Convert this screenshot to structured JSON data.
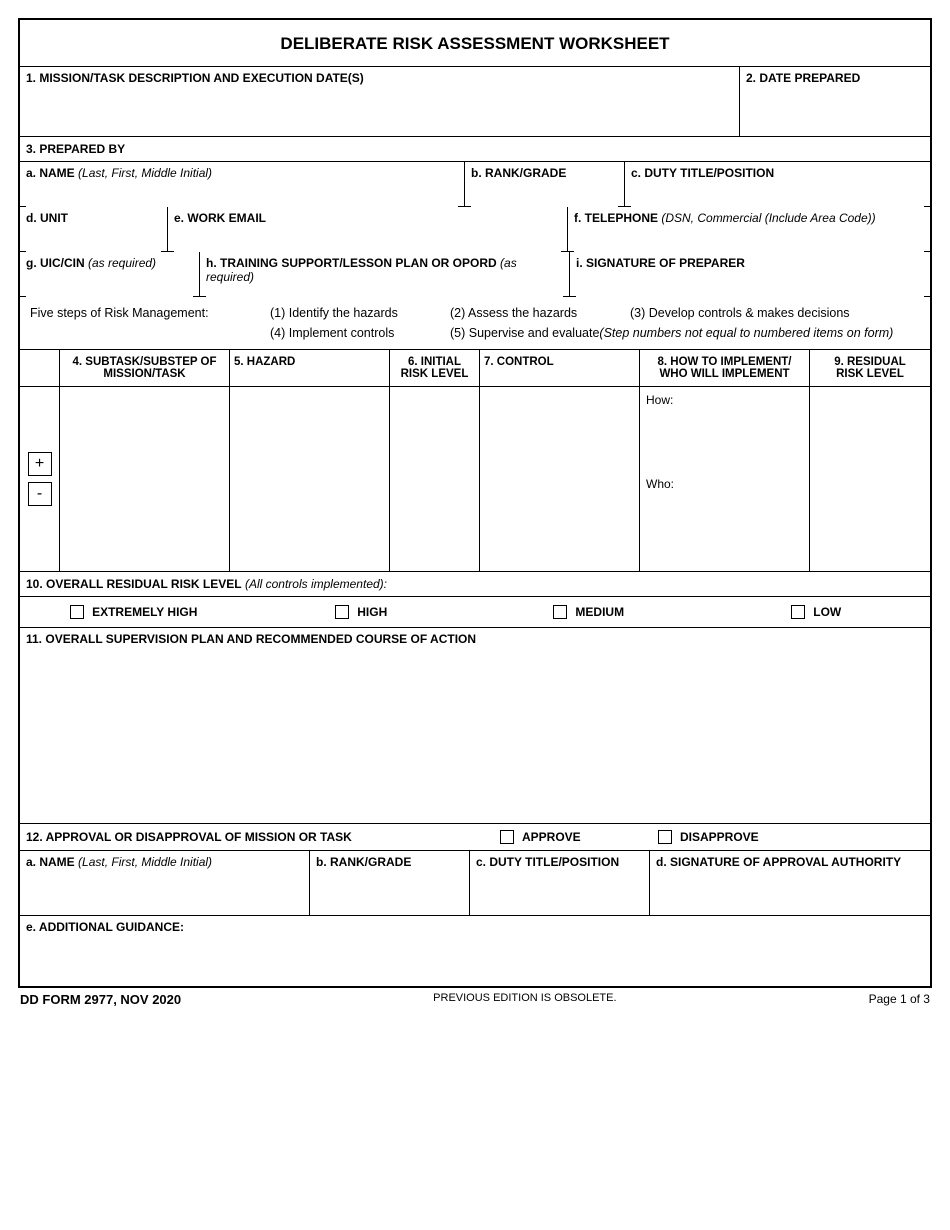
{
  "title": "DELIBERATE RISK ASSESSMENT WORKSHEET",
  "fields": {
    "f1": "1. MISSION/TASK DESCRIPTION AND EXECUTION DATE(S)",
    "f2": "2. DATE PREPARED",
    "f3": "3. PREPARED BY",
    "f3a_label": "a. NAME",
    "f3a_hint": " (Last, First, Middle Initial)",
    "f3b": "b. RANK/GRADE",
    "f3c": "c. DUTY TITLE/POSITION",
    "f3d": "d. UNIT",
    "f3e": "e. WORK EMAIL",
    "f3f_label": "f. TELEPHONE",
    "f3f_hint": " (DSN, Commercial (Include Area Code))",
    "f3g_label": "g. UIC/CIN",
    "f3g_hint": " (as required)",
    "f3h_label": "h. TRAINING SUPPORT/LESSON PLAN OR OPORD",
    "f3h_hint": " (as required)",
    "f3i": "i. SIGNATURE OF PREPARER"
  },
  "steps": {
    "intro": "Five steps of Risk Management:",
    "s1": "(1) Identify the hazards",
    "s2": "(2) Assess the hazards",
    "s3": "(3) Develop controls & makes decisions",
    "s4": "(4) Implement controls",
    "s5_label": "(5) Supervise and evaluate",
    "s5_hint": " (Step numbers not equal to numbered items on form)"
  },
  "hazard_headers": {
    "h4a": "4. SUBTASK/SUBSTEP OF",
    "h4b": "MISSION/TASK",
    "h5": "5. HAZARD",
    "h6a": "6. INITIAL",
    "h6b": "RISK LEVEL",
    "h7": "7. CONTROL",
    "h8a": "8. HOW TO IMPLEMENT/",
    "h8b": "WHO WILL IMPLEMENT",
    "h9a": "9. RESIDUAL",
    "h9b": "RISK LEVEL"
  },
  "hazard_body": {
    "how": "How:",
    "who": "Who:"
  },
  "buttons": {
    "plus": "+",
    "minus": "-"
  },
  "f10_label": "10. OVERALL RESIDUAL RISK LEVEL",
  "f10_hint": " (All controls implemented):",
  "risk_levels": {
    "eh": "EXTREMELY HIGH",
    "h": "HIGH",
    "m": "MEDIUM",
    "l": "LOW"
  },
  "f11": "11. OVERALL SUPERVISION PLAN AND RECOMMENDED COURSE OF ACTION",
  "f12": "12. APPROVAL OR DISAPPROVAL OF MISSION OR TASK",
  "approve": "APPROVE",
  "disapprove": "DISAPPROVE",
  "f12a_label": "a. NAME",
  "f12a_hint": " (Last, First, Middle Initial)",
  "f12b": "b. RANK/GRADE",
  "f12c": "c. DUTY TITLE/POSITION",
  "f12d": "d. SIGNATURE OF APPROVAL AUTHORITY",
  "f12e": "e. ADDITIONAL GUIDANCE:",
  "footer": {
    "form": "DD FORM 2977, NOV 2020",
    "obsolete": "PREVIOUS EDITION IS OBSOLETE.",
    "page": "Page 1 of 3"
  }
}
